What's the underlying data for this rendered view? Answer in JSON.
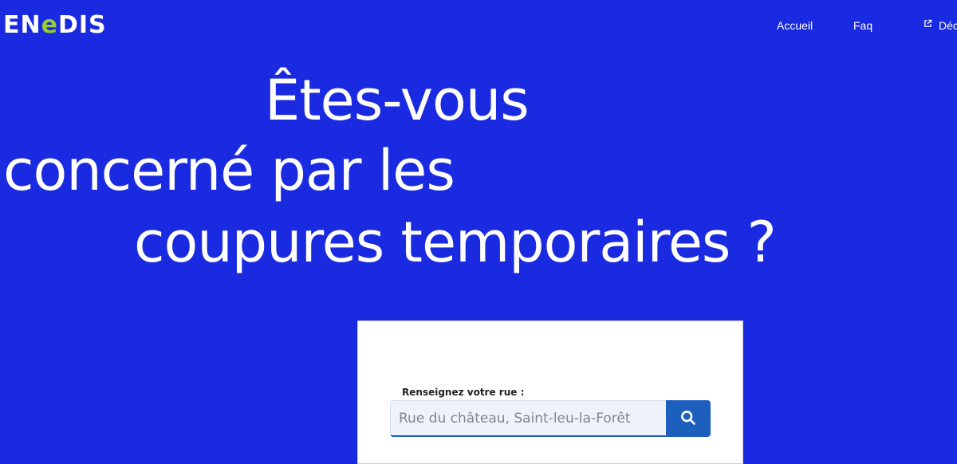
{
  "brand": {
    "logo_start": "EN",
    "logo_accent": "e",
    "logo_end": "DIS",
    "accent_color": "#96cd32",
    "background_color": "#1a2ae0"
  },
  "nav": {
    "items": [
      {
        "label": "Accueil"
      },
      {
        "label": "Faq"
      },
      {
        "label": "Déc",
        "icon": "external-link-icon"
      }
    ]
  },
  "hero": {
    "line1": "Êtes-vous",
    "line2": "concerné par les",
    "line3": "coupures temporaires ?"
  },
  "search": {
    "label": "Renseignez votre rue :",
    "placeholder": "Rue du château, Saint-leu-la-Forêt",
    "button_icon": "search-icon"
  }
}
